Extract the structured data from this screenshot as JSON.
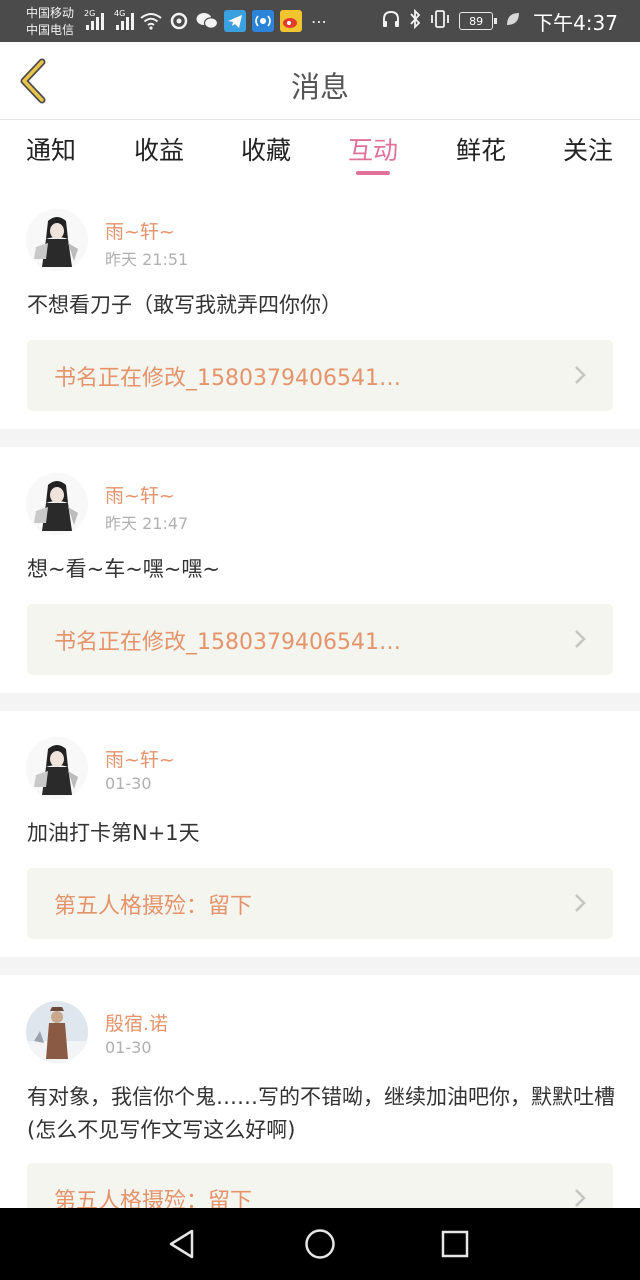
{
  "status_bar": {
    "carrier_1": "中国移动",
    "carrier_2": "中国电信",
    "net_1": "2G",
    "net_2": "4G",
    "battery": "89",
    "time": "下午4:37",
    "icons": [
      "signal-2g-icon",
      "signal-4g-icon",
      "wifi-icon",
      "sync-icon",
      "wechat-icon",
      "telegram-icon",
      "radio-app-icon",
      "weibo-icon",
      "more-icon",
      "headphone-icon",
      "bluetooth-icon",
      "vibrate-icon",
      "battery-icon",
      "leaf-icon"
    ]
  },
  "header": {
    "title": "消息",
    "back_icon": "chevron-left-icon"
  },
  "tabs": [
    {
      "label": "通知",
      "active": false
    },
    {
      "label": "收益",
      "active": false
    },
    {
      "label": "收藏",
      "active": false
    },
    {
      "label": "互动",
      "active": true
    },
    {
      "label": "鲜花",
      "active": false
    },
    {
      "label": "关注",
      "active": false
    }
  ],
  "colors": {
    "accent_pink": "#e0729a",
    "name_orange": "#e4936a",
    "book_bg": "#f5f5f0",
    "separator": "#f4f4f4"
  },
  "messages": [
    {
      "user": "雨~轩~",
      "time": "昨天 21:51",
      "comment": "不想看刀子（敢写我就弄四你你）",
      "book": "书名正在修改_1580379406541…"
    },
    {
      "user": "雨~轩~",
      "time": "昨天 21:47",
      "comment": "想~看~车~嘿~嘿~",
      "book": "书名正在修改_1580379406541…"
    },
    {
      "user": "雨~轩~",
      "time": "01-30",
      "comment": "加油打卡第N+1天",
      "book": "第五人格摄殓：留下"
    },
    {
      "user": "殷宿.诺",
      "time": "01-30",
      "comment": "有对象，我信你个鬼……写的不错呦，继续加油吧你，默默吐槽(怎么不见写作文写这么好啊)",
      "book": "第五人格摄殓：留下"
    }
  ],
  "nav_bar": {
    "icons": [
      "back-triangle-icon",
      "home-circle-icon",
      "recents-square-icon"
    ]
  }
}
